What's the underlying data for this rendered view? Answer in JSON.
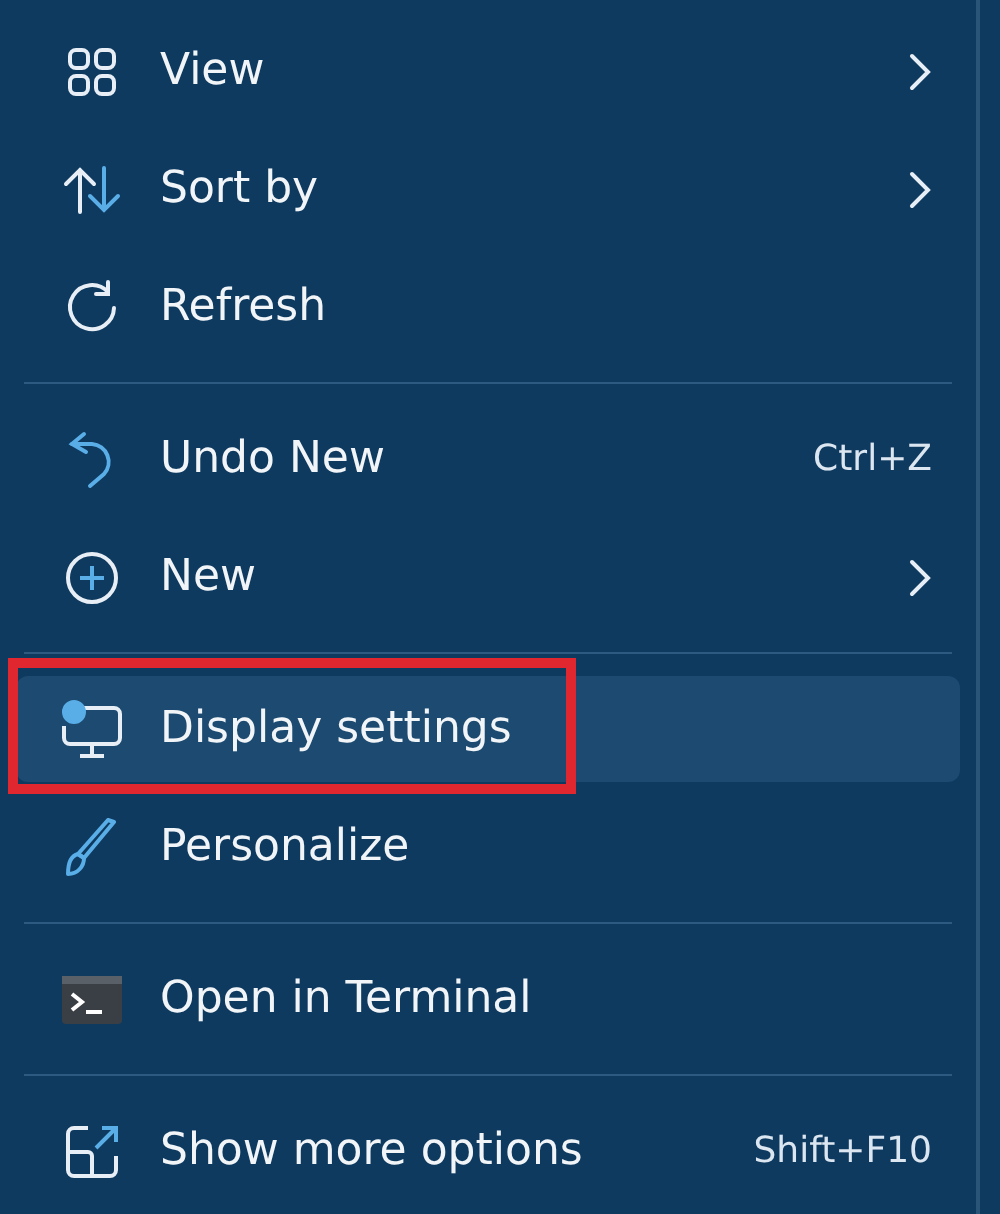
{
  "menu": {
    "sections": [
      [
        {
          "label": "View",
          "submenu": true,
          "hovered": false,
          "annotated": false
        },
        {
          "label": "Sort by",
          "submenu": true,
          "hovered": false,
          "annotated": false
        },
        {
          "label": "Refresh",
          "submenu": false,
          "hovered": false,
          "annotated": false
        }
      ],
      [
        {
          "label": "Undo New",
          "shortcut": "Ctrl+Z",
          "submenu": false,
          "hovered": false,
          "annotated": false
        },
        {
          "label": "New",
          "submenu": true,
          "hovered": false,
          "annotated": false
        }
      ],
      [
        {
          "label": "Display settings",
          "submenu": false,
          "hovered": true,
          "annotated": true
        },
        {
          "label": "Personalize",
          "submenu": false,
          "hovered": false,
          "annotated": false
        }
      ],
      [
        {
          "label": "Open in Terminal",
          "submenu": false,
          "hovered": false,
          "annotated": false
        }
      ],
      [
        {
          "label": "Show more options",
          "shortcut": "Shift+F10",
          "submenu": false,
          "hovered": false,
          "annotated": false
        }
      ]
    ]
  }
}
